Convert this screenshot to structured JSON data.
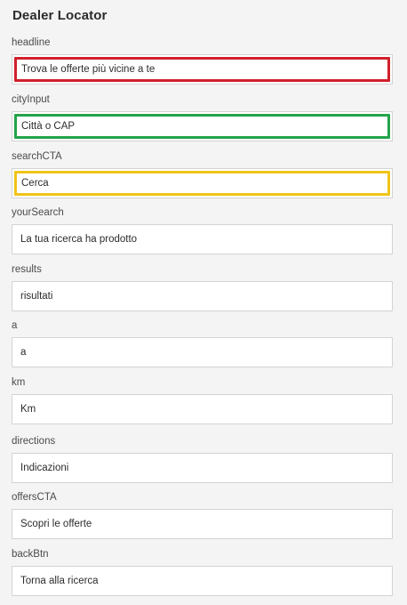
{
  "panel": {
    "title": "Dealer Locator"
  },
  "fields": [
    {
      "label": "headline",
      "value": "Trova le offerte più vicine a te",
      "highlight": "#d0202b"
    },
    {
      "label": "cityInput",
      "value": "Città o CAP",
      "highlight": "#24a34a"
    },
    {
      "label": "searchCTA",
      "value": "Cerca",
      "highlight": "#f0c419"
    },
    {
      "label": "yourSearch",
      "value": "La tua ricerca ha prodotto"
    },
    {
      "label": "results",
      "value": "risultati"
    },
    {
      "label": "a",
      "value": "a"
    },
    {
      "label": "km",
      "value": "Km"
    },
    {
      "label": "directions",
      "value": "Indicazioni"
    },
    {
      "label": "offersCTA",
      "value": "Scopri le offerte"
    },
    {
      "label": "backBtn",
      "value": "Torna alla ricerca"
    }
  ]
}
